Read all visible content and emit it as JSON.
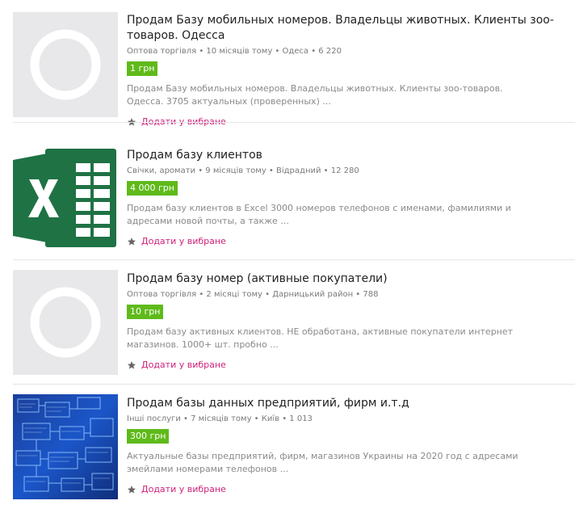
{
  "favorite_label": "Додати у вибране",
  "listings": [
    {
      "title": "Продам Базу мобильных номеров. Владельцы животных. Клиенты зоо-товаров. Одесса",
      "meta": "Оптова торгівля • 10 місяців тому • Одеса • 6 220",
      "price": "1 грн",
      "description": "Продам Базу мобильных номеров. Владельцы животных. Клиенты зоо-товаров. Одесса. 3705 актуальных (проверенных) ...",
      "image": "placeholder-icon"
    },
    {
      "title": "Продам базу клиентов",
      "meta": "Свічки, аромати • 9 місяців тому • Відрадний • 12 280",
      "price": "4 000 грн",
      "description": "Продам базу клиентов в Excel 3000 номеров телефонов с именами, фамилиями и адресами новой почты, а также ...",
      "image": "excel-logo"
    },
    {
      "title": "Продам базу номер (активные покупатели)",
      "meta": "Оптова торгівля • 2 місяці тому • Дарницький район • 788",
      "price": "10 грн",
      "description": "Продам базу активных клиентов. НЕ обработана, активные покупатели интернет магазинов. 1000+ шт. пробно ...",
      "image": "placeholder-icon"
    },
    {
      "title": "Продам базы данных предприятий, фирм и.т.д",
      "meta": "Інші послуги • 7 місяців тому • Київ • 1 013",
      "price": "300 грн",
      "description": "Актуальные базы предприятий, фирм, магазинов Украины на 2020 год с адресами эмейлами номерами телефонов ...",
      "image": "database-diagram"
    }
  ],
  "colors": {
    "price_bg": "#5fba1a",
    "favorite_text": "#d0207a",
    "excel_green": "#1f7244",
    "placeholder_bg": "#e8e8ea",
    "db_blue": "#1b56c9"
  }
}
